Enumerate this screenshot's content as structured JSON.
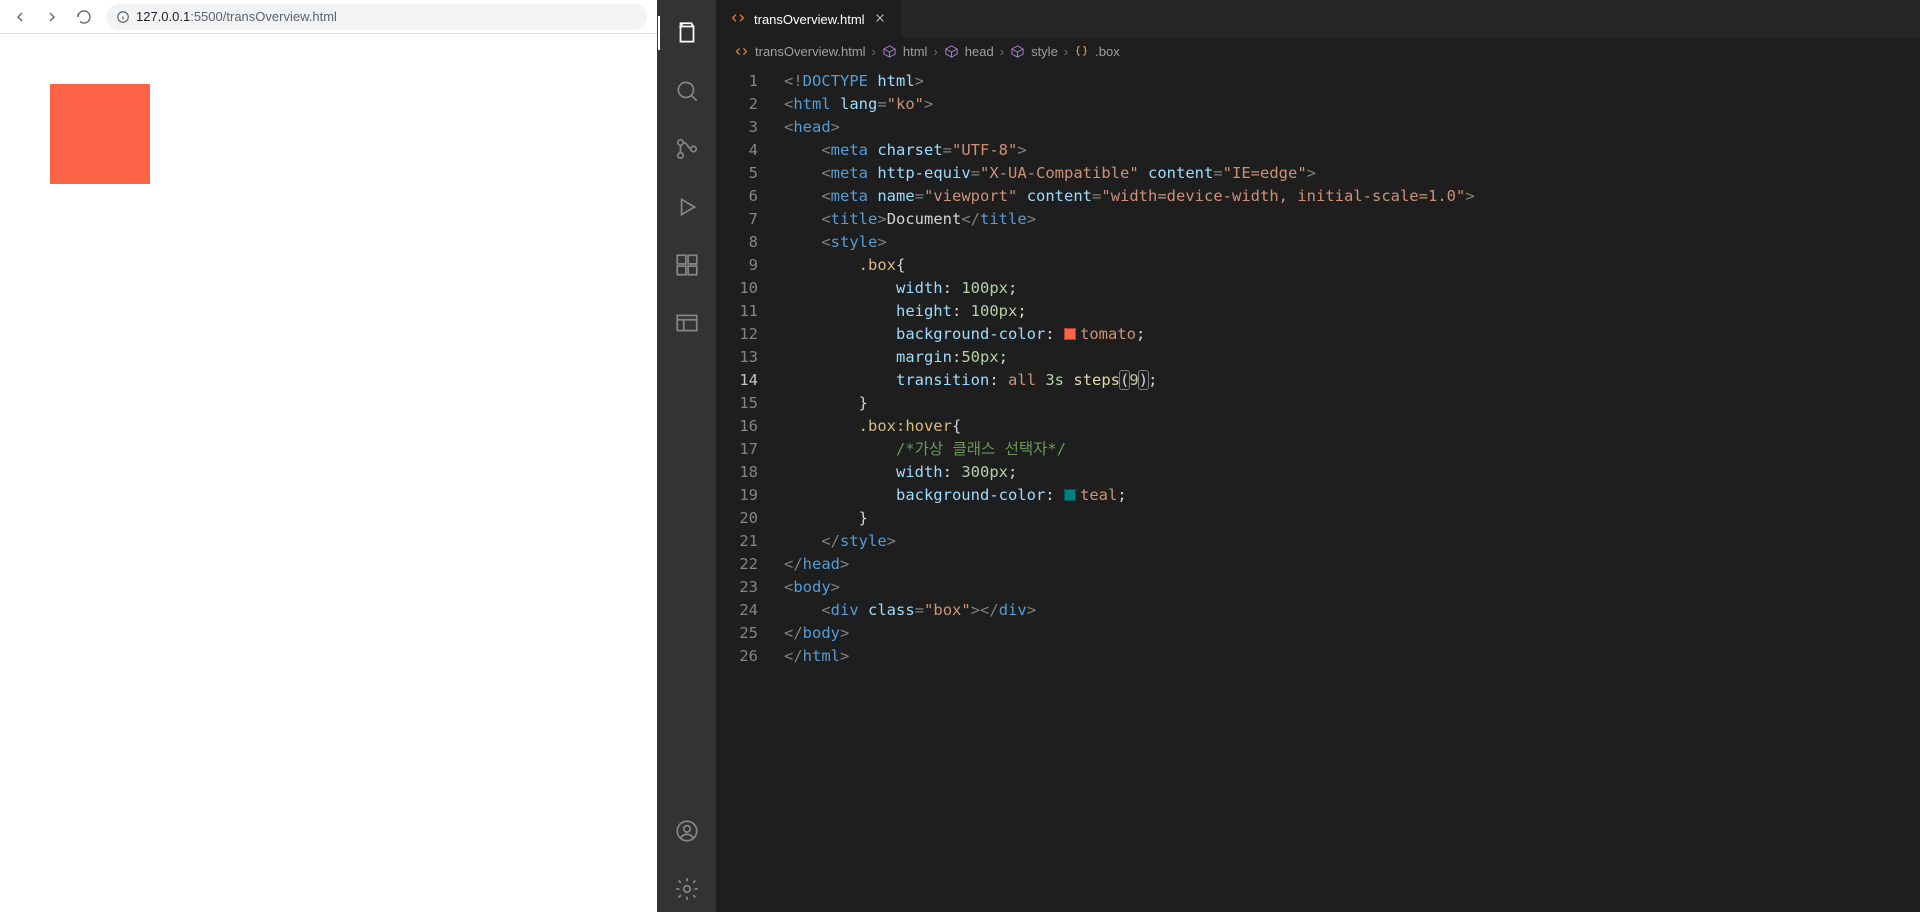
{
  "browser": {
    "url_host": "127.0.0.1",
    "url_port": ":5500",
    "url_path": "/transOverview.html"
  },
  "vscode": {
    "tab": {
      "filename": "transOverview.html"
    },
    "breadcrumbs": {
      "file": "transOverview.html",
      "c1": "html",
      "c2": "head",
      "c3": "style",
      "c4": ".box"
    },
    "activity": {
      "explorer": "explorer",
      "search": "search",
      "scm": "source-control",
      "debug": "run-debug",
      "extensions": "extensions",
      "preview": "live-preview",
      "account": "account",
      "settings": "settings"
    },
    "code": {
      "lines": [
        {
          "n": "1",
          "html": "<span class='t-punct'>&lt;!</span><span class='t-doctype'>DOCTYPE</span> <span class='t-attr'>html</span><span class='t-punct'>&gt;</span>"
        },
        {
          "n": "2",
          "html": "<span class='t-punct'>&lt;</span><span class='t-tag'>html</span> <span class='t-attr'>lang</span><span class='t-punct'>=</span><span class='t-str'>\"ko\"</span><span class='t-punct'>&gt;</span>"
        },
        {
          "n": "3",
          "html": "<span class='t-punct'>&lt;</span><span class='t-tag'>head</span><span class='t-punct'>&gt;</span>"
        },
        {
          "n": "4",
          "html": "    <span class='t-punct'>&lt;</span><span class='t-tag'>meta</span> <span class='t-attr'>charset</span><span class='t-punct'>=</span><span class='t-str'>\"UTF-8\"</span><span class='t-punct'>&gt;</span>"
        },
        {
          "n": "5",
          "html": "    <span class='t-punct'>&lt;</span><span class='t-tag'>meta</span> <span class='t-attr'>http-equiv</span><span class='t-punct'>=</span><span class='t-str'>\"X-UA-Compatible\"</span> <span class='t-attr'>content</span><span class='t-punct'>=</span><span class='t-str'>\"IE=edge\"</span><span class='t-punct'>&gt;</span>"
        },
        {
          "n": "6",
          "html": "    <span class='t-punct'>&lt;</span><span class='t-tag'>meta</span> <span class='t-attr'>name</span><span class='t-punct'>=</span><span class='t-str'>\"viewport\"</span> <span class='t-attr'>content</span><span class='t-punct'>=</span><span class='t-str'>\"width=device-width, initial-scale=1.0\"</span><span class='t-punct'>&gt;</span>"
        },
        {
          "n": "7",
          "html": "    <span class='t-punct'>&lt;</span><span class='t-tag'>title</span><span class='t-punct'>&gt;</span><span class='t-text'>Document</span><span class='t-punct'>&lt;/</span><span class='t-tag'>title</span><span class='t-punct'>&gt;</span>"
        },
        {
          "n": "8",
          "html": "    <span class='t-punct'>&lt;</span><span class='t-tag'>style</span><span class='t-punct'>&gt;</span>"
        },
        {
          "n": "9",
          "html": "        <span class='t-sel'>.box</span><span class='t-white'>{</span>"
        },
        {
          "n": "10",
          "html": "            <span class='t-prop'>width</span><span class='t-white'>:</span> <span class='t-num'>100px</span><span class='t-white'>;</span>"
        },
        {
          "n": "11",
          "html": "            <span class='t-prop'>height</span><span class='t-white'>:</span> <span class='t-num'>100px</span><span class='t-white'>;</span>"
        },
        {
          "n": "12",
          "html": "            <span class='t-prop'>background-color</span><span class='t-white'>:</span> <span class='color-swatch' style='background:#ff6347'></span><span class='t-val'>tomato</span><span class='t-white'>;</span>"
        },
        {
          "n": "13",
          "html": "            <span class='t-prop'>margin</span><span class='t-white'>:</span><span class='t-num'>50px</span><span class='t-white'>;</span>"
        },
        {
          "n": "14",
          "html": "            <span class='t-prop'>transition</span><span class='t-white'>:</span> <span class='t-val'>all</span> <span class='t-num'>3s</span> <span class='t-func'>steps</span><span class='t-white t-bracket-hl'>(</span><span class='t-num'>9</span><span class='t-white t-bracket-hl'>)</span><span class='t-white'>;</span>",
          "current": true
        },
        {
          "n": "15",
          "html": "        <span class='t-white'>}</span>"
        },
        {
          "n": "16",
          "html": "        <span class='t-sel'>.box:hover</span><span class='t-white'>{</span>"
        },
        {
          "n": "17",
          "html": "            <span class='t-comment'>/*가상 클래스 선택자*/</span>"
        },
        {
          "n": "18",
          "html": "            <span class='t-prop'>width</span><span class='t-white'>:</span> <span class='t-num'>300px</span><span class='t-white'>;</span>"
        },
        {
          "n": "19",
          "html": "            <span class='t-prop'>background-color</span><span class='t-white'>:</span> <span class='color-swatch' style='background:#008080'></span><span class='t-val'>teal</span><span class='t-white'>;</span>"
        },
        {
          "n": "20",
          "html": "        <span class='t-white'>}</span>"
        },
        {
          "n": "21",
          "html": "    <span class='t-punct'>&lt;/</span><span class='t-tag'>style</span><span class='t-punct'>&gt;</span>"
        },
        {
          "n": "22",
          "html": "<span class='t-punct'>&lt;/</span><span class='t-tag'>head</span><span class='t-punct'>&gt;</span>"
        },
        {
          "n": "23",
          "html": "<span class='t-punct'>&lt;</span><span class='t-tag'>body</span><span class='t-punct'>&gt;</span>"
        },
        {
          "n": "24",
          "html": "    <span class='t-punct'>&lt;</span><span class='t-tag'>div</span> <span class='t-attr'>class</span><span class='t-punct'>=</span><span class='t-str'>\"box\"</span><span class='t-punct'>&gt;&lt;/</span><span class='t-tag'>div</span><span class='t-punct'>&gt;</span>"
        },
        {
          "n": "25",
          "html": "<span class='t-punct'>&lt;/</span><span class='t-tag'>body</span><span class='t-punct'>&gt;</span>"
        },
        {
          "n": "26",
          "html": "<span class='t-punct'>&lt;/</span><span class='t-tag'>html</span><span class='t-punct'>&gt;</span>"
        }
      ]
    }
  }
}
